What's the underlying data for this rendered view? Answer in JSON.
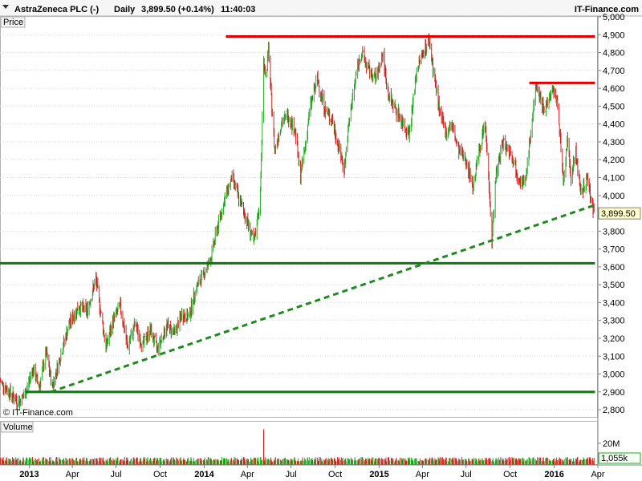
{
  "header": {
    "symbol_title": "AstraZeneca PLC (-)",
    "period": "Daily",
    "price_change": "3,899.50 (+0.14%)",
    "time": "11:40:03",
    "brand": "IT-Finance.com",
    "copyright": "© IT-Finance.com"
  },
  "panels": {
    "price_tab": "Price",
    "volume_tab": "Volume"
  },
  "colors": {
    "up_candle": "#22aa22",
    "down_candle": "#cc2222",
    "resistance": "#e00000",
    "support": "#0a7a0a",
    "trendline": "#1f8a1f",
    "grid": "#d8d8d8",
    "last_price_badge": "#ffffcc"
  },
  "chart_data": {
    "type": "line",
    "title": "AstraZeneca PLC (-)",
    "interval": "Daily",
    "last_price": 3899.5,
    "last_price_label": "3,899.50",
    "change_percent": 0.14,
    "y_axis": {
      "range": [
        2760,
        5000
      ],
      "ticks": [
        {
          "value": 2800,
          "label": "2,800"
        },
        {
          "value": 2900,
          "label": "2,900"
        },
        {
          "value": 3000,
          "label": "3,000"
        },
        {
          "value": 3100,
          "label": "3,100"
        },
        {
          "value": 3200,
          "label": "3,200"
        },
        {
          "value": 3300,
          "label": "3,300"
        },
        {
          "value": 3400,
          "label": "3,400"
        },
        {
          "value": 3500,
          "label": "3,500"
        },
        {
          "value": 3600,
          "label": "3,600"
        },
        {
          "value": 3700,
          "label": "3,700"
        },
        {
          "value": 3800,
          "label": "3,800"
        },
        {
          "value": 3900,
          "label": "3,900"
        },
        {
          "value": 4000,
          "label": "4,000"
        },
        {
          "value": 4100,
          "label": "4,100"
        },
        {
          "value": 4200,
          "label": "4,200"
        },
        {
          "value": 4300,
          "label": "4,300"
        },
        {
          "value": 4400,
          "label": "4,400"
        },
        {
          "value": 4500,
          "label": "4,500"
        },
        {
          "value": 4600,
          "label": "4,600"
        },
        {
          "value": 4700,
          "label": "4,700"
        },
        {
          "value": 4800,
          "label": "4,800"
        },
        {
          "value": 4900,
          "label": "4,900"
        },
        {
          "value": 5000,
          "label": "5,000"
        }
      ]
    },
    "x_axis": {
      "range": [
        "2012-11-01",
        "2016-04-01"
      ],
      "ticks": [
        {
          "date": "2013-01-01",
          "label": "2013",
          "bold": true
        },
        {
          "date": "2013-04-01",
          "label": "Apr",
          "bold": false
        },
        {
          "date": "2013-07-01",
          "label": "Jul",
          "bold": false
        },
        {
          "date": "2013-10-01",
          "label": "Oct",
          "bold": false
        },
        {
          "date": "2014-01-01",
          "label": "2014",
          "bold": true
        },
        {
          "date": "2014-04-01",
          "label": "Apr",
          "bold": false
        },
        {
          "date": "2014-07-01",
          "label": "Jul",
          "bold": false
        },
        {
          "date": "2014-10-01",
          "label": "Oct",
          "bold": false
        },
        {
          "date": "2015-01-01",
          "label": "2015",
          "bold": true
        },
        {
          "date": "2015-04-01",
          "label": "Apr",
          "bold": false
        },
        {
          "date": "2015-07-01",
          "label": "Jul",
          "bold": false
        },
        {
          "date": "2015-10-01",
          "label": "Oct",
          "bold": false
        },
        {
          "date": "2016-01-01",
          "label": "2016",
          "bold": true
        },
        {
          "date": "2016-04-01",
          "label": "Apr",
          "bold": false
        }
      ]
    },
    "price_path": [
      [
        "2012-11-01",
        2960
      ],
      [
        "2012-11-20",
        2900
      ],
      [
        "2012-12-10",
        2840
      ],
      [
        "2012-12-24",
        2890
      ],
      [
        "2013-01-08",
        3030
      ],
      [
        "2013-01-22",
        2930
      ],
      [
        "2013-02-05",
        3120
      ],
      [
        "2013-02-18",
        2930
      ],
      [
        "2013-03-05",
        3080
      ],
      [
        "2013-03-25",
        3280
      ],
      [
        "2013-04-15",
        3380
      ],
      [
        "2013-05-01",
        3350
      ],
      [
        "2013-05-20",
        3530
      ],
      [
        "2013-06-10",
        3150
      ],
      [
        "2013-06-25",
        3300
      ],
      [
        "2013-07-10",
        3380
      ],
      [
        "2013-07-25",
        3150
      ],
      [
        "2013-08-10",
        3280
      ],
      [
        "2013-08-25",
        3160
      ],
      [
        "2013-09-10",
        3250
      ],
      [
        "2013-09-25",
        3140
      ],
      [
        "2013-10-15",
        3270
      ],
      [
        "2013-10-31",
        3230
      ],
      [
        "2013-11-15",
        3330
      ],
      [
        "2013-11-30",
        3320
      ],
      [
        "2013-12-15",
        3480
      ],
      [
        "2013-12-31",
        3560
      ],
      [
        "2014-01-15",
        3650
      ],
      [
        "2014-01-31",
        3850
      ],
      [
        "2014-02-15",
        4000
      ],
      [
        "2014-02-28",
        4100
      ],
      [
        "2014-03-15",
        3980
      ],
      [
        "2014-04-01",
        3850
      ],
      [
        "2014-04-15",
        3730
      ],
      [
        "2014-04-28",
        4000
      ],
      [
        "2014-05-05",
        4750
      ],
      [
        "2014-05-10",
        4660
      ],
      [
        "2014-05-15",
        4820
      ],
      [
        "2014-05-20",
        4580
      ],
      [
        "2014-05-28",
        4250
      ],
      [
        "2014-06-10",
        4400
      ],
      [
        "2014-06-25",
        4450
      ],
      [
        "2014-07-10",
        4360
      ],
      [
        "2014-07-20",
        4100
      ],
      [
        "2014-08-01",
        4300
      ],
      [
        "2014-08-10",
        4500
      ],
      [
        "2014-08-25",
        4650
      ],
      [
        "2014-09-10",
        4480
      ],
      [
        "2014-09-25",
        4420
      ],
      [
        "2014-10-10",
        4250
      ],
      [
        "2014-10-20",
        4150
      ],
      [
        "2014-11-01",
        4450
      ],
      [
        "2014-11-15",
        4700
      ],
      [
        "2014-11-25",
        4800
      ],
      [
        "2014-12-10",
        4700
      ],
      [
        "2014-12-25",
        4650
      ],
      [
        "2015-01-08",
        4790
      ],
      [
        "2015-01-20",
        4560
      ],
      [
        "2015-02-05",
        4480
      ],
      [
        "2015-02-20",
        4400
      ],
      [
        "2015-03-05",
        4350
      ],
      [
        "2015-03-20",
        4700
      ],
      [
        "2015-04-02",
        4800
      ],
      [
        "2015-04-15",
        4870
      ],
      [
        "2015-04-25",
        4680
      ],
      [
        "2015-05-08",
        4450
      ],
      [
        "2015-05-20",
        4350
      ],
      [
        "2015-06-01",
        4400
      ],
      [
        "2015-06-15",
        4250
      ],
      [
        "2015-07-01",
        4200
      ],
      [
        "2015-07-15",
        4050
      ],
      [
        "2015-08-01",
        4300
      ],
      [
        "2015-08-10",
        4400
      ],
      [
        "2015-08-20",
        3970
      ],
      [
        "2015-08-24",
        3740
      ],
      [
        "2015-09-01",
        4100
      ],
      [
        "2015-09-15",
        4300
      ],
      [
        "2015-10-01",
        4250
      ],
      [
        "2015-10-15",
        4130
      ],
      [
        "2015-11-01",
        4050
      ],
      [
        "2015-11-15",
        4400
      ],
      [
        "2015-11-25",
        4620
      ],
      [
        "2015-12-10",
        4480
      ],
      [
        "2015-12-31",
        4600
      ],
      [
        "2016-01-10",
        4470
      ],
      [
        "2016-01-20",
        4050
      ],
      [
        "2016-01-28",
        4300
      ],
      [
        "2016-02-05",
        4100
      ],
      [
        "2016-02-15",
        4250
      ],
      [
        "2016-02-25",
        4000
      ],
      [
        "2016-03-10",
        4100
      ],
      [
        "2016-03-20",
        3950
      ],
      [
        "2016-03-24",
        3899.5
      ]
    ],
    "overlays": [
      {
        "kind": "horizontal",
        "style": "solid",
        "color": "#e00000",
        "value": 4890,
        "from": "2014-02-15",
        "to": "2016-03-26"
      },
      {
        "kind": "horizontal",
        "style": "solid",
        "color": "#e00000",
        "value": 4630,
        "from": "2015-11-10",
        "to": "2016-03-26"
      },
      {
        "kind": "horizontal",
        "style": "solid",
        "color": "#0a7a0a",
        "value": 3620,
        "from": "2012-11-01",
        "to": "2016-03-26"
      },
      {
        "kind": "horizontal",
        "style": "solid",
        "color": "#0a7a0a",
        "value": 2900,
        "from": "2012-12-24",
        "to": "2016-03-26"
      },
      {
        "kind": "trend",
        "style": "dashed",
        "color": "#1f8a1f",
        "from": [
          "2013-02-15",
          2900
        ],
        "to": [
          "2016-03-30",
          3950
        ]
      }
    ],
    "volume": {
      "axis_ticks": [
        {
          "value": 20,
          "label": "20M"
        }
      ],
      "last_label": "1,055k",
      "spike": {
        "date": "2014-05-05",
        "value": 33
      }
    }
  }
}
